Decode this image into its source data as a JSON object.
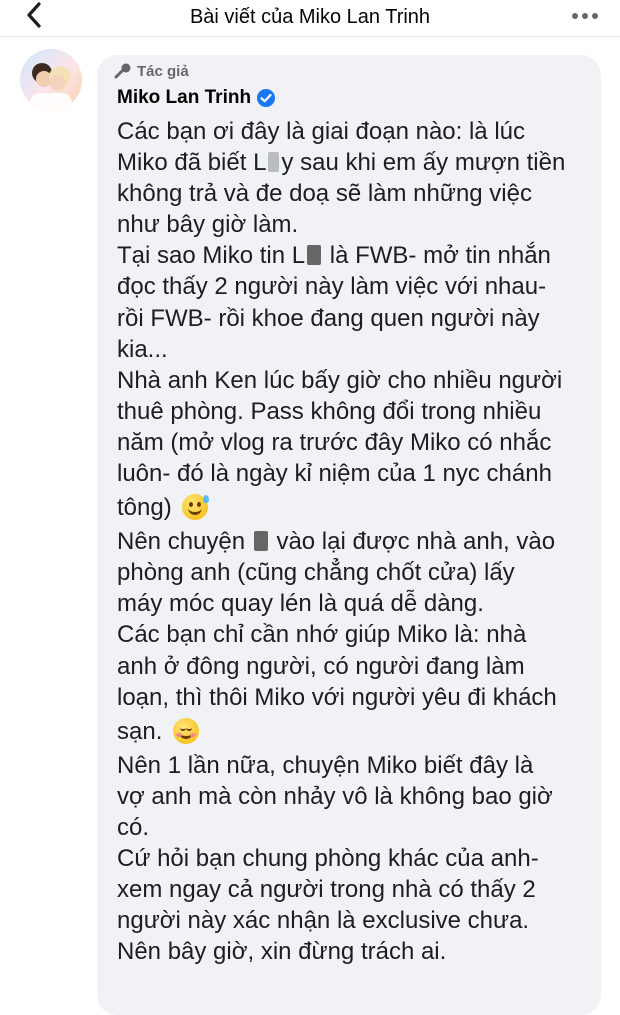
{
  "header": {
    "title": "Bài viết của Miko Lan Trinh",
    "back_icon": "chevron-left-icon",
    "more_icon": "more-horizontal-icon"
  },
  "comment": {
    "author_badge": "Tác giả",
    "author_name": "Miko Lan Trinh",
    "verified": true,
    "lines": [
      "Các bạn ơi đây là giai đoạn nào: là lúc",
      "Miko đã biết L",
      "y sau khi em ấy mượn tiền",
      "không trả và đe doạ sẽ làm những việc",
      "như bây giờ làm.",
      "Tại sao Miko tin L",
      "là FWB- mở tin nhắn",
      "đọc thấy 2 người này làm việc với nhau-",
      "rồi FWB- rồi khoe đang quen người này",
      "kia...",
      "Nhà anh Ken lúc bấy giờ cho nhiều người",
      "thuê phòng. Pass không đổi trong nhiều",
      "năm (mở vlog ra trước đây Miko có nhắc",
      "luôn- đó là ngày kỉ niệm của 1 nyc chánh",
      "tông)",
      "Nên chuyện",
      "vào lại được nhà anh, vào",
      "phòng anh (cũng chẳng chốt cửa) lấy",
      "máy móc quay lén là quá dễ dàng.",
      "Các bạn chỉ cần nhớ giúp Miko là: nhà",
      "anh ở đông người, có người đang làm",
      "loạn, thì thôi Miko với người yêu đi khách",
      "sạn.",
      "Nên 1 lần nữa, chuyện Miko biết đây là",
      "vợ anh mà còn nhảy vô là không bao giờ",
      "có.",
      "Cứ hỏi bạn chung phòng khác của anh-",
      "xem ngay cả người trong nhà có thấy 2",
      "người này xác nhận là exclusive chưa.",
      "Nên bây giờ, xin đừng trách ai."
    ]
  },
  "colors": {
    "bubble_bg": "#f0f2f5",
    "verified_blue": "#1877f2",
    "muted_text": "#65676b"
  }
}
